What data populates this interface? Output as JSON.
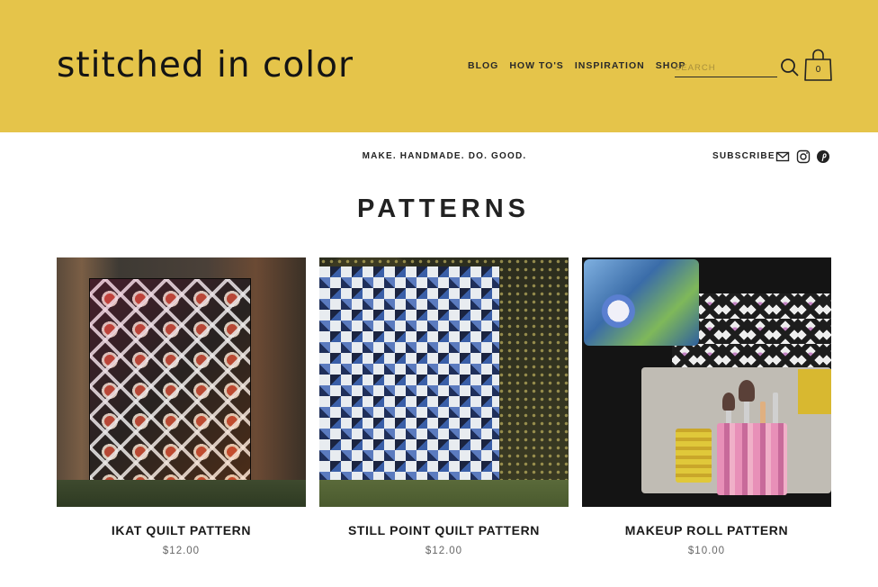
{
  "header": {
    "logo": "stitched in color",
    "nav": [
      {
        "label": "BLOG"
      },
      {
        "label": "HOW TO'S"
      },
      {
        "label": "INSPIRATION"
      },
      {
        "label": "SHOP"
      }
    ],
    "search_placeholder": "SEARCH",
    "cart_count": "0"
  },
  "tagline": "MAKE. HANDMADE. DO. GOOD.",
  "subscribe_label": "SUBSCRIBE",
  "social_icons": [
    "mail-icon",
    "instagram-icon",
    "pinterest-icon"
  ],
  "page_title": "PATTERNS",
  "products": [
    {
      "name": "IKAT QUILT PATTERN",
      "price": "$12.00"
    },
    {
      "name": "STILL POINT QUILT PATTERN",
      "price": "$12.00"
    },
    {
      "name": "MAKEUP ROLL PATTERN",
      "price": "$10.00"
    }
  ],
  "colors": {
    "header_bg": "#e5c44a",
    "text": "#222222",
    "price": "#666666"
  }
}
